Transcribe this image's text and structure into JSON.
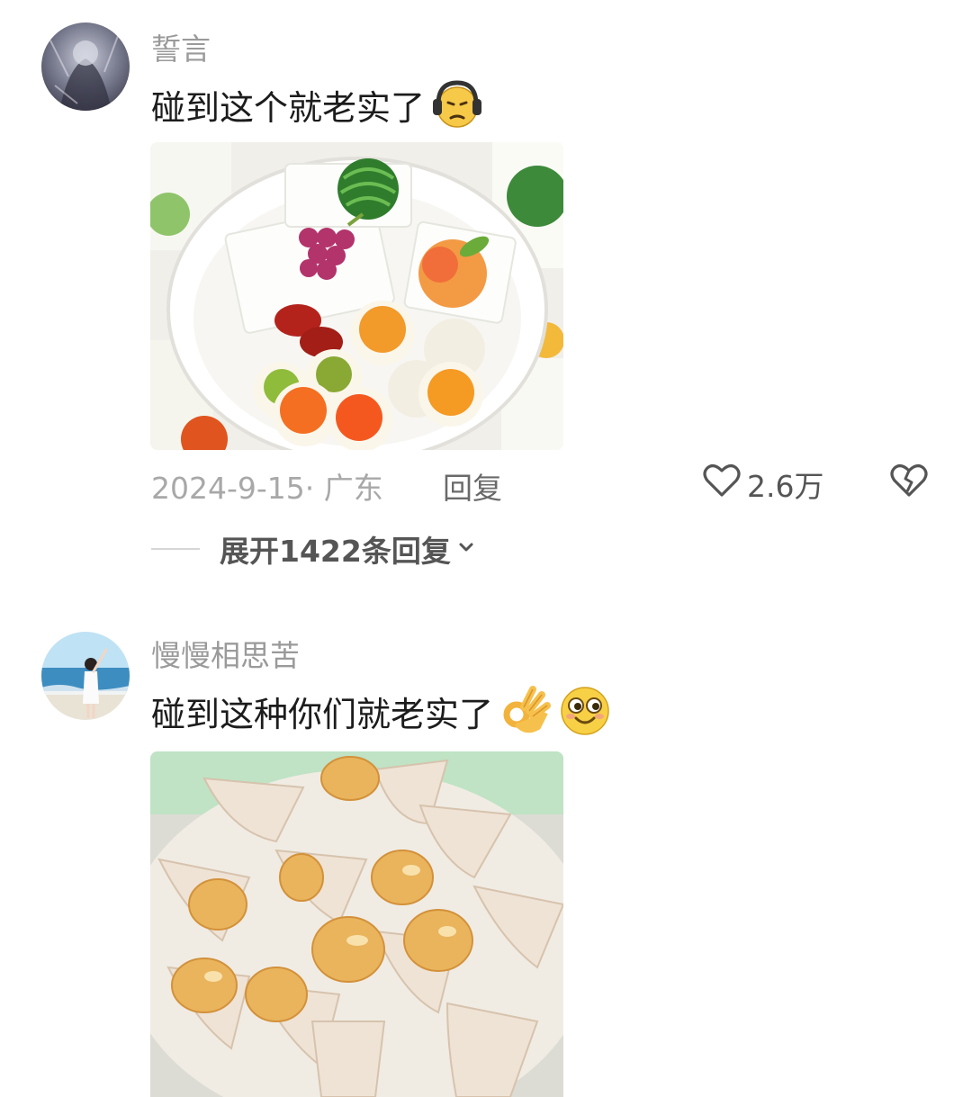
{
  "comments": [
    {
      "username": "誓言",
      "text": "碰到这个就老实了",
      "emojis": [
        "headphones-face-emoji"
      ],
      "date_location": "2024-9-15· 广东",
      "reply_label": "回复",
      "like_count": "2.6万",
      "expand_label": "展开1422条回复"
    },
    {
      "username": "慢慢相思苦",
      "text": "碰到这种你们就老实了",
      "emojis": [
        "ok-hand-emoji",
        "smiling-face-emoji"
      ]
    }
  ],
  "icons": {
    "like": "heart-outline-icon",
    "dislike": "broken-heart-icon",
    "expand": "chevron-down-icon"
  }
}
